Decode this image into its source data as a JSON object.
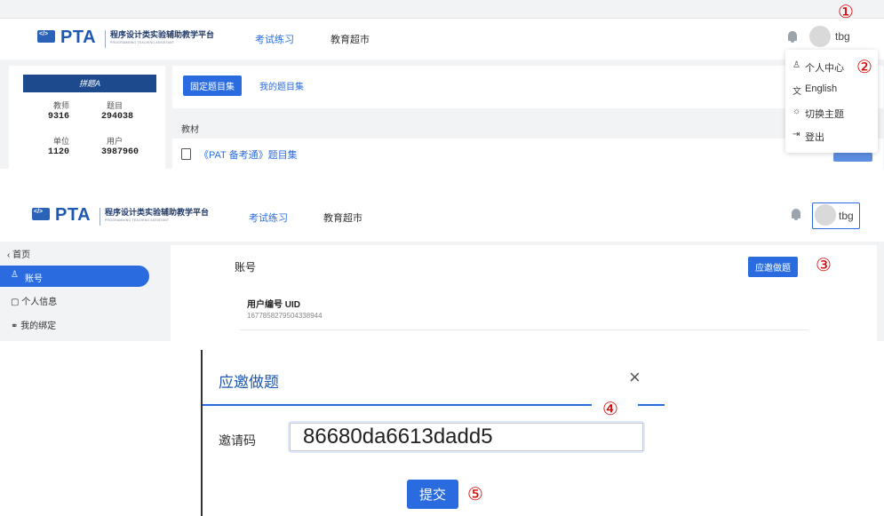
{
  "app": {
    "logo_text": "PTA",
    "logo_subtitle": "程序设计类实验辅助教学平台",
    "logo_subtitle_en": "PROGRAMMING TEACHING ASSISTANT",
    "nav": [
      {
        "label": "考试练习",
        "active": true
      },
      {
        "label": "教育超市",
        "active": false
      }
    ],
    "username": "tbg",
    "accent_color": "#2a6ce0",
    "annotation_color": "#d40000"
  },
  "panel1": {
    "marker_user": "①",
    "marker_profile": "②",
    "stats_header": "拼题A",
    "stats": [
      {
        "label": "教师",
        "value": "9316"
      },
      {
        "label": "题目",
        "value": "294038"
      },
      {
        "label": "单位",
        "value": "1120"
      },
      {
        "label": "用户",
        "value": "3987960"
      }
    ],
    "tabs": [
      {
        "label": "固定题目集",
        "active": true
      },
      {
        "label": "我的题目集",
        "active": false
      }
    ],
    "section_title": "教材",
    "book_link": "《PAT 备考通》题目集",
    "user_menu": [
      {
        "icon": "person-icon",
        "glyph": "♙",
        "label": "个人中心"
      },
      {
        "icon": "translate-icon",
        "glyph": "文",
        "label": "English"
      },
      {
        "icon": "sun-icon",
        "glyph": "☼",
        "label": "切换主题"
      },
      {
        "icon": "logout-icon",
        "glyph": "⇥",
        "label": "登出"
      }
    ]
  },
  "panel2": {
    "back_label": "首页",
    "sidebar": [
      {
        "label": "账号",
        "active": true,
        "icon": "person-icon",
        "glyph": "♙"
      },
      {
        "label": "个人信息",
        "active": false,
        "icon": "document-icon",
        "glyph": "▢"
      },
      {
        "label": "我的绑定",
        "active": false,
        "icon": "link-icon",
        "glyph": "⚭"
      }
    ],
    "account_title": "账号",
    "invite_button": "应邀做题",
    "marker_invite": "③",
    "uid_label": "用户编号 UID",
    "uid_value": "1677858279504338944"
  },
  "panel3": {
    "dialog_title": "应邀做题",
    "close_glyph": "×",
    "marker_input": "④",
    "field_label": "邀请码",
    "invite_code": "86680da6613dadd5",
    "submit_button": "提交",
    "marker_submit": "⑤"
  }
}
